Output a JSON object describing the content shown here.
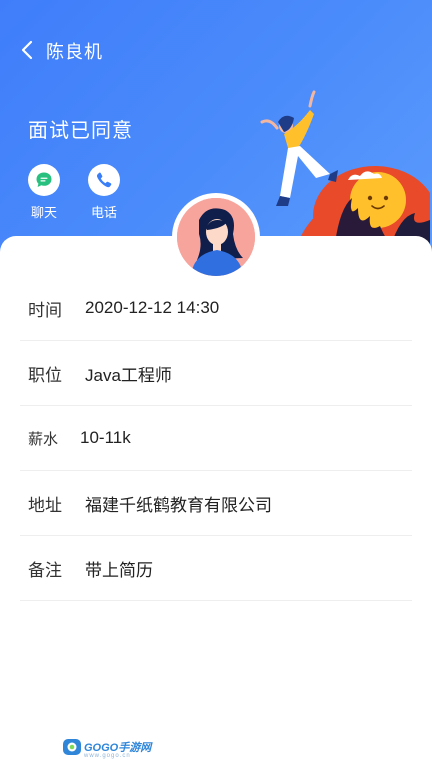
{
  "nav": {
    "title": "陈良机"
  },
  "status": "面试已同意",
  "actions": [
    {
      "label": "聊天",
      "icon": "chat-icon"
    },
    {
      "label": "电话",
      "icon": "phone-icon"
    }
  ],
  "details": [
    {
      "key": "时间",
      "value": "2020-12-12 14:30"
    },
    {
      "key": "职位",
      "value": "Java工程师"
    },
    {
      "key": "薪水",
      "value": "10-11k"
    },
    {
      "key": "地址",
      "value": "福建千纸鹤教育有限公司"
    },
    {
      "key": "备注",
      "value": "带上简历"
    }
  ],
  "watermark": {
    "brand": "GOGO手游网",
    "url": "www.gogo.cn"
  },
  "colors": {
    "header": "#4b8cfb",
    "chat_accent": "#27c07f",
    "phone_accent": "#3a7ef8"
  }
}
